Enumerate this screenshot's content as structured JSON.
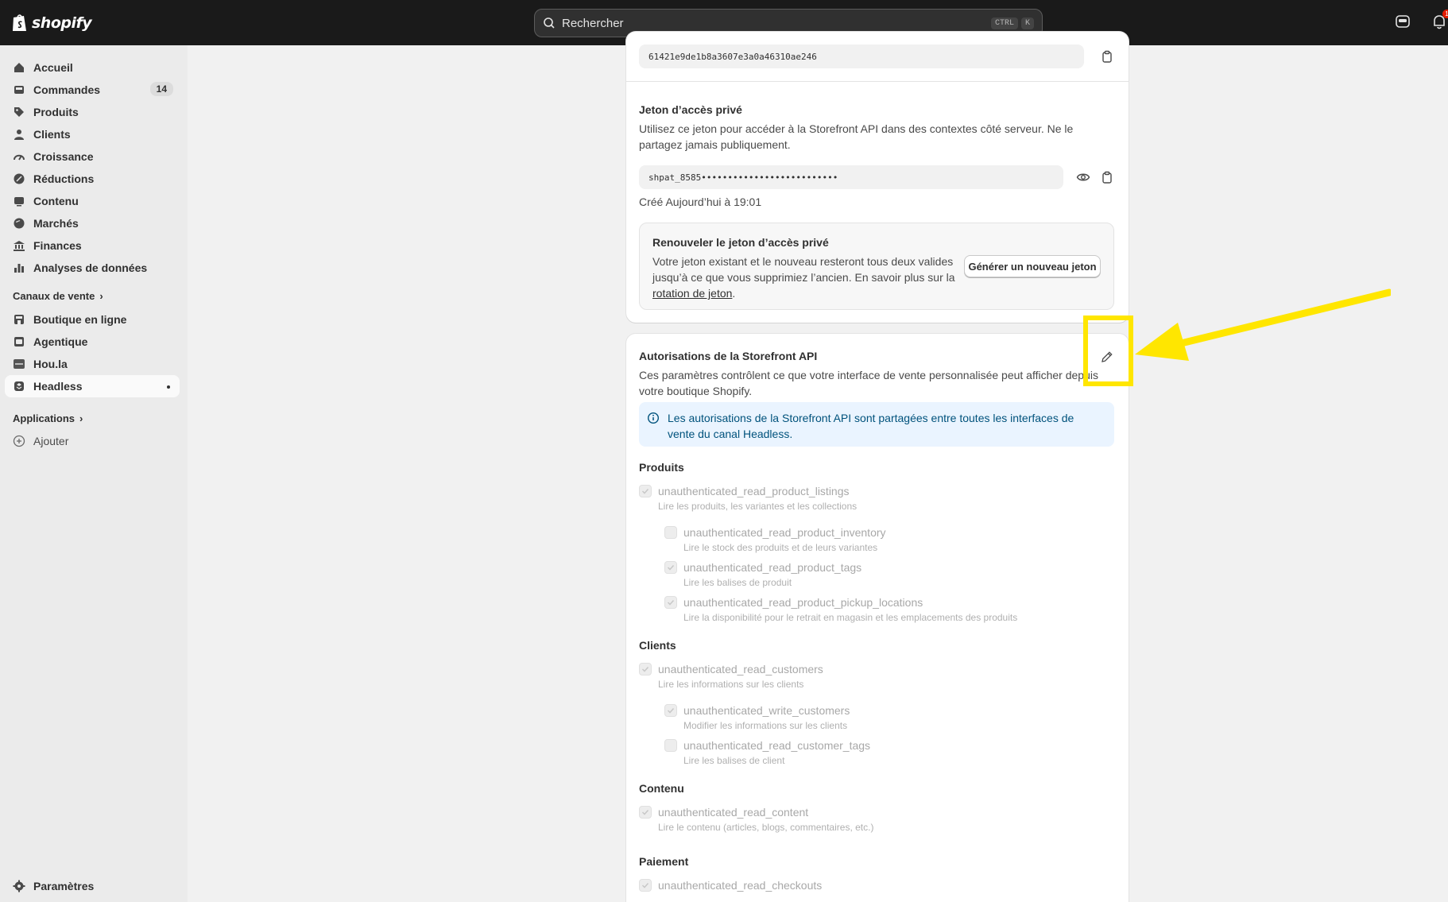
{
  "topbar": {
    "logo_text": "shopify",
    "search_placeholder": "Rechercher",
    "kbd_ctrl": "CTRL",
    "kbd_k": "K",
    "notification_count": "1"
  },
  "sidebar": {
    "items": [
      {
        "label": "Accueil",
        "icon": "home-icon"
      },
      {
        "label": "Commandes",
        "icon": "orders-icon",
        "count": "14"
      },
      {
        "label": "Produits",
        "icon": "tag-icon"
      },
      {
        "label": "Clients",
        "icon": "person-icon"
      },
      {
        "label": "Croissance",
        "icon": "growth-icon"
      },
      {
        "label": "Réductions",
        "icon": "discount-icon"
      },
      {
        "label": "Contenu",
        "icon": "content-icon"
      },
      {
        "label": "Marchés",
        "icon": "globe-icon"
      },
      {
        "label": "Finances",
        "icon": "bank-icon"
      },
      {
        "label": "Analyses de données",
        "icon": "chart-icon"
      }
    ],
    "sales_channels_label": "Canaux de vente",
    "channels": [
      {
        "label": "Boutique en ligne"
      },
      {
        "label": "Agentique"
      },
      {
        "label": "Hou.la"
      },
      {
        "label": "Headless"
      }
    ],
    "apps_label": "Applications",
    "add_label": "Ajouter",
    "settings_label": "Paramètres"
  },
  "card1": {
    "public_token": "61421e9de1b8a3607e3a0a46310ae246",
    "private_title": "Jeton d’accès privé",
    "private_desc_line1": "Utilisez ce jeton pour accéder à la Storefront API dans des contextes côté serveur. Ne le",
    "private_desc_line2": "partagez jamais publiquement.",
    "private_token": "shpat_8585••••••••••••••••••••••••••",
    "created": "Créé Aujourd’hui à 19:01",
    "renew_title": "Renouveler le jeton d’accès privé",
    "renew_line1": "Votre jeton existant et le nouveau resteront tous deux valides",
    "renew_line2": "jusqu’à ce que vous supprimiez l’ancien. En savoir plus sur la",
    "renew_link": "rotation de jeton",
    "renew_period": ".",
    "generate_button": "Générer un nouveau jeton"
  },
  "card2": {
    "title": "Autorisations de la Storefront API",
    "desc_line1": "Ces paramètres contrôlent ce que votre interface de vente personnalisée peut afficher depuis",
    "desc_line2": "votre boutique Shopify.",
    "info_line1": "Les autorisations de la Storefront API sont partagées entre toutes les interfaces de",
    "info_line2": "vente du canal Headless.",
    "sections": {
      "products": "Produits",
      "customers": "Clients",
      "content": "Contenu",
      "payment": "Paiement"
    },
    "perms": {
      "p1": {
        "name": "unauthenticated_read_product_listings",
        "desc": "Lire les produits, les variantes et les collections",
        "checked": true
      },
      "p2": {
        "name": "unauthenticated_read_product_inventory",
        "desc": "Lire le stock des produits et de leurs variantes",
        "checked": false
      },
      "p3": {
        "name": "unauthenticated_read_product_tags",
        "desc": "Lire les balises de produit",
        "checked": true
      },
      "p4": {
        "name": "unauthenticated_read_product_pickup_locations",
        "desc": "Lire la disponibilité pour le retrait en magasin et les emplacements des produits",
        "checked": true
      },
      "c1": {
        "name": "unauthenticated_read_customers",
        "desc": "Lire les informations sur les clients",
        "checked": true
      },
      "c2": {
        "name": "unauthenticated_write_customers",
        "desc": "Modifier les informations sur les clients",
        "checked": true
      },
      "c3": {
        "name": "unauthenticated_read_customer_tags",
        "desc": "Lire les balises de client",
        "checked": false
      },
      "ct1": {
        "name": "unauthenticated_read_content",
        "desc": "Lire le contenu (articles, blogs, commentaires, etc.)",
        "checked": true
      },
      "pay1": {
        "name": "unauthenticated_read_checkouts",
        "desc": "",
        "checked": true
      }
    }
  },
  "colors": {
    "topbar": "#1a1a1a",
    "annotation": "#ffe600",
    "info_bg": "#eaf4ff"
  }
}
